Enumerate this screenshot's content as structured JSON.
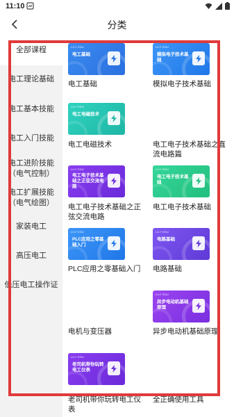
{
  "status_bar": {
    "time": "11:10"
  },
  "header": {
    "title": "分类"
  },
  "sidebar": {
    "items": [
      {
        "label": "全部课程",
        "active": true
      },
      {
        "label": "电工理论基础"
      },
      {
        "label": "电工基本技能"
      },
      {
        "label": "电工入门技能"
      },
      {
        "label": "电工进阶技能（电气控制）"
      },
      {
        "label": "电工扩展技能（电气绘图）"
      },
      {
        "label": "家装电工"
      },
      {
        "label": "高压电工"
      },
      {
        "label": "低压电工操作证"
      }
    ]
  },
  "courses": [
    {
      "title": "电工基础",
      "thumb_text": "电工基础",
      "color": "blue"
    },
    {
      "title": "模拟电子技术基础",
      "thumb_text": "模拟电子技术基础",
      "color": "lightblue"
    },
    {
      "title": "电工电磁技术",
      "thumb_text": "电工电磁技术",
      "color": "teal"
    },
    {
      "title": "电工电子技术基础之直流电路篇",
      "thumb_text": "",
      "color": ""
    },
    {
      "title": "电工电子技术基础之正弦交流电路",
      "thumb_text": "电工电子技术基础之正弦交流电路",
      "color": "purple"
    },
    {
      "title": "电工电子技术基础",
      "thumb_text": "电工电子技术基础",
      "color": "green"
    },
    {
      "title": "PLC应用之零基础入门",
      "thumb_text": "PLC应用之零基础入门",
      "color": "lightblue"
    },
    {
      "title": "电路基础",
      "thumb_text": "电路基础",
      "color": "violet"
    },
    {
      "title": "电机与变压器",
      "thumb_text": "",
      "color": ""
    },
    {
      "title": "异步电动机基础原理",
      "thumb_text": "异步电动机基础原理",
      "color": "purple2"
    },
    {
      "title": "老司机带你玩转电工仪表",
      "thumb_text": "老司机带你玩转电工仪表",
      "color": "purple"
    },
    {
      "title": "全正确使用工具",
      "thumb_text": "",
      "color": ""
    }
  ],
  "thumb_brand": "LILY EDU",
  "highlight_color": "#e03a3a"
}
